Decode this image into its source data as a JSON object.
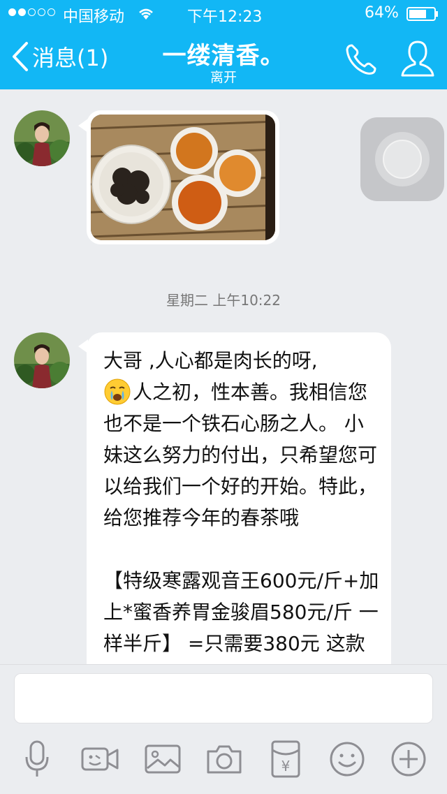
{
  "status_bar": {
    "carrier": "中国移动",
    "time": "下午12:23",
    "battery": "64%",
    "signal_bars": 2
  },
  "nav": {
    "back_label": "消息(1)",
    "title": "一缕清香。",
    "subtitle": "离开"
  },
  "chat": {
    "timestamp": "星期二 上午10:22",
    "message_pre_emoji": "大哥 ,人心都是肉长的呀,",
    "message_post_emoji": "人之初，性本善。我相信您也不是一个铁石心肠之人。 小妹这么努力的付出，只希望您可以给我们一个好的开始。特此，给您推荐今年的春茶哦",
    "message_para2": "【特级寒露观音王600元/斤+加上*蜜香养胃金骏眉580元/斤 一样半斤】 =只需要380元 这款组合对养胃"
  },
  "input": {
    "placeholder": ""
  },
  "toolbar": {
    "icons": [
      "microphone-icon",
      "video-icon",
      "image-icon",
      "camera-icon",
      "red-packet-icon",
      "emoji-icon",
      "plus-icon"
    ],
    "red_packet_symbol": "¥"
  },
  "colors": {
    "accent": "#12b7f5",
    "background": "#ebedf0",
    "icon_gray": "#8e8e93"
  }
}
